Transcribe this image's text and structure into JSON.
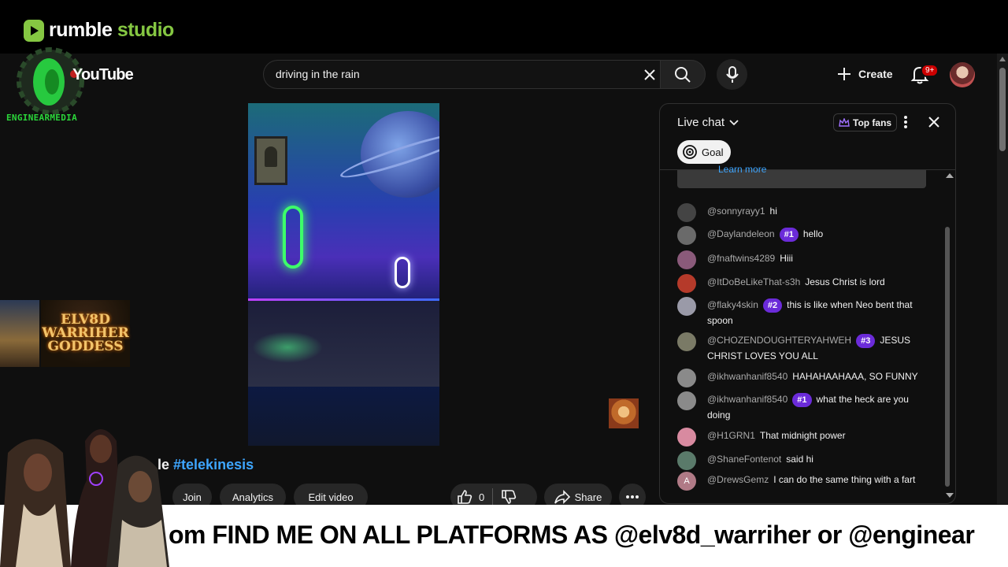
{
  "rumble": {
    "brand_part1": "rumble",
    "brand_part2": "studio",
    "accent": "#85c742"
  },
  "overlay_logo": {
    "name": "ENGINEARMEDIA"
  },
  "youtube": {
    "wordmark": "YouTube"
  },
  "search": {
    "value": "driving in the rain"
  },
  "header": {
    "create_label": "Create",
    "notifications_badge": "9+"
  },
  "video": {
    "title_prefix": "le",
    "title_hashtag": "#telekinesis",
    "actions": {
      "join": "Join",
      "analytics": "Analytics",
      "edit": "Edit video",
      "likes": "0",
      "share": "Share"
    }
  },
  "goddess_card": {
    "line1": "ELV8D",
    "line2": "WARRIHER",
    "line3": "GODDESS"
  },
  "chat": {
    "title": "Live chat",
    "top_fans": "Top fans",
    "goal": "Goal",
    "banner_link": "Learn more",
    "messages": [
      {
        "user": "@sonnyrayy1",
        "badge": "",
        "text": "hi",
        "avatar_color": "#444"
      },
      {
        "user": "@Daylandeleon",
        "badge": "#1",
        "text": "hello",
        "avatar_color": "#6a6a6a"
      },
      {
        "user": "@fnaftwins4289",
        "badge": "",
        "text": "Hiii",
        "avatar_color": "#8a5a7a"
      },
      {
        "user": "@ItDoBeLikeThat-s3h",
        "badge": "",
        "text": "Jesus Christ is lord",
        "avatar_color": "#b53a2a"
      },
      {
        "user": "@flaky4skin",
        "badge": "#2",
        "text": "this is like when Neo bent that spoon",
        "avatar_color": "#9a9aa8"
      },
      {
        "user": "@CHOZENDOUGHTERYAHWEH",
        "badge": "#3",
        "text": "JESUS CHRIST LOVES YOU ALL",
        "avatar_color": "#7a7a66"
      },
      {
        "user": "@ikhwanhanif8540",
        "badge": "",
        "text": "HAHAHAAHAAA, SO FUNNY",
        "avatar_color": "#8a8a8a"
      },
      {
        "user": "@ikhwanhanif8540",
        "badge": "#1",
        "text": "what the heck are you doing",
        "avatar_color": "#8a8a8a"
      },
      {
        "user": "@H1GRN1",
        "badge": "",
        "text": "That midnight power",
        "avatar_color": "#d88aa0"
      },
      {
        "user": "@ShaneFontenot",
        "badge": "",
        "text": "said hi",
        "avatar_color": "#5a7a6a"
      },
      {
        "user": "@DrewsGemz",
        "badge": "",
        "text": "I can do the same thing with a fart",
        "avatar_color": "#b07a86",
        "avatar_letter": "A"
      }
    ]
  },
  "ticker": {
    "text": "om FIND ME ON ALL PLATFORMS AS @elv8d_warriher or @enginear"
  }
}
